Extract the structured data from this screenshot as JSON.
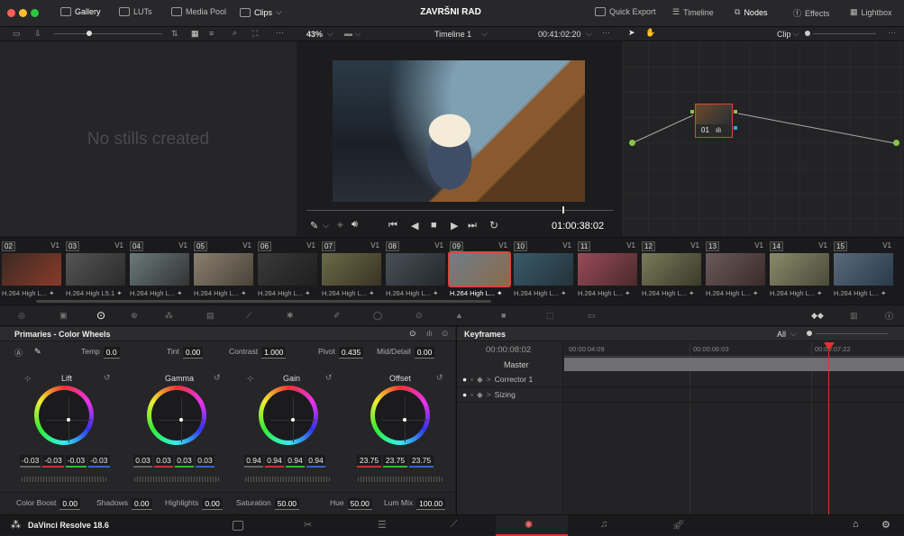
{
  "app": {
    "project_title": "ZAVRŠNI RAD",
    "version_label": "DaVinci Resolve 18.6"
  },
  "topbar": {
    "left_tabs": [
      {
        "label": "Gallery",
        "icon": "gallery-icon"
      },
      {
        "label": "LUTs",
        "icon": "luts-icon"
      },
      {
        "label": "Media Pool",
        "icon": "media-pool-icon"
      },
      {
        "label": "Clips",
        "icon": "clips-icon"
      }
    ],
    "right_items": [
      {
        "label": "Quick Export",
        "icon": "export-icon"
      },
      {
        "label": "Timeline",
        "icon": "timeline-icon"
      },
      {
        "label": "Nodes",
        "icon": "nodes-icon"
      },
      {
        "label": "Effects",
        "icon": "fx-icon"
      },
      {
        "label": "Lightbox",
        "icon": "lightbox-icon"
      }
    ]
  },
  "viewer_bar": {
    "zoom": "43%",
    "timeline_name": "Timeline 1",
    "timecode": "00:41:02:20",
    "node_mode": "Clip"
  },
  "gallery": {
    "empty_text": "No stills created"
  },
  "viewer": {
    "current_timecode": "01:00:38:02"
  },
  "node": {
    "label": "01"
  },
  "clips": [
    {
      "num": "02",
      "track": "V1",
      "codec": "H.264 High L...",
      "colors": [
        "#3a2a22",
        "#8a3a2a"
      ]
    },
    {
      "num": "03",
      "track": "V1",
      "codec": "H.264 High L5.1",
      "colors": [
        "#555",
        "#2b2b2b"
      ]
    },
    {
      "num": "04",
      "track": "V1",
      "codec": "H.264 High L...",
      "colors": [
        "#6a7a7a",
        "#333"
      ]
    },
    {
      "num": "05",
      "track": "V1",
      "codec": "H.264 High L...",
      "colors": [
        "#8a8070",
        "#4a4238"
      ]
    },
    {
      "num": "06",
      "track": "V1",
      "codec": "H.264 High L...",
      "colors": [
        "#3a3a3a",
        "#1e1e1e"
      ]
    },
    {
      "num": "07",
      "track": "V1",
      "codec": "H.264 High L...",
      "colors": [
        "#6a6a48",
        "#3a3424"
      ]
    },
    {
      "num": "08",
      "track": "V1",
      "codec": "H.264 High L...",
      "colors": [
        "#4a5058",
        "#24282c"
      ]
    },
    {
      "num": "09",
      "track": "V1",
      "codec": "H.264 High L...",
      "colors": [
        "#6e7e8a",
        "#8a6a4a"
      ]
    },
    {
      "num": "10",
      "track": "V1",
      "codec": "H.264 High L...",
      "colors": [
        "#3a5a6a",
        "#23333a"
      ]
    },
    {
      "num": "11",
      "track": "V1",
      "codec": "H.264 High L...",
      "colors": [
        "#9a4a5a",
        "#4a2a2a"
      ]
    },
    {
      "num": "12",
      "track": "V1",
      "codec": "H.264 High L...",
      "colors": [
        "#7a7a5a",
        "#3a3a2a"
      ]
    },
    {
      "num": "13",
      "track": "V1",
      "codec": "H.264 High L...",
      "colors": [
        "#6a5a5a",
        "#3a2a2a"
      ]
    },
    {
      "num": "14",
      "track": "V1",
      "codec": "H.264 High L...",
      "colors": [
        "#8a8a6a",
        "#4a4a3a"
      ]
    },
    {
      "num": "15",
      "track": "V1",
      "codec": "H.264 High L...",
      "colors": [
        "#5a6a7a",
        "#2a3a4a"
      ]
    }
  ],
  "selected_clip": "09",
  "primaries": {
    "title": "Primaries - Color Wheels",
    "temp_label": "Temp",
    "temp": "0.0",
    "tint_label": "Tint",
    "tint": "0.00",
    "contrast_label": "Contrast",
    "contrast": "1.000",
    "pivot_label": "Pivot",
    "pivot": "0.435",
    "middetail_label": "Mid/Detail",
    "middetail": "0.00",
    "wheels": [
      {
        "label": "Lift",
        "values": [
          "-0.03",
          "-0.03",
          "-0.03",
          "-0.03"
        ]
      },
      {
        "label": "Gamma",
        "values": [
          "0.03",
          "0.03",
          "0.03",
          "0.03"
        ]
      },
      {
        "label": "Gain",
        "values": [
          "0.94",
          "0.94",
          "0.94",
          "0.94"
        ]
      },
      {
        "label": "Offset",
        "values": [
          "23.75",
          "23.75",
          "23.75"
        ]
      }
    ],
    "bottom": [
      {
        "label": "Color Boost",
        "value": "0.00"
      },
      {
        "label": "Shadows",
        "value": "0.00"
      },
      {
        "label": "Highlights",
        "value": "0.00"
      },
      {
        "label": "Saturation",
        "value": "50.00"
      },
      {
        "label": "Hue",
        "value": "50.00"
      },
      {
        "label": "Lum Mix",
        "value": "100.00"
      }
    ]
  },
  "keyframes": {
    "title": "Keyframes",
    "filter": "All",
    "timecode": "00:00:08:02",
    "ruler": [
      "00:00:04:09",
      "00:00:06:03",
      "00:00:07:22"
    ],
    "master": "Master",
    "tracks": [
      "Corrector 1",
      "Sizing"
    ]
  },
  "colors": {
    "accent_red": "#e0322e",
    "selected_outline": "#d9473c"
  }
}
